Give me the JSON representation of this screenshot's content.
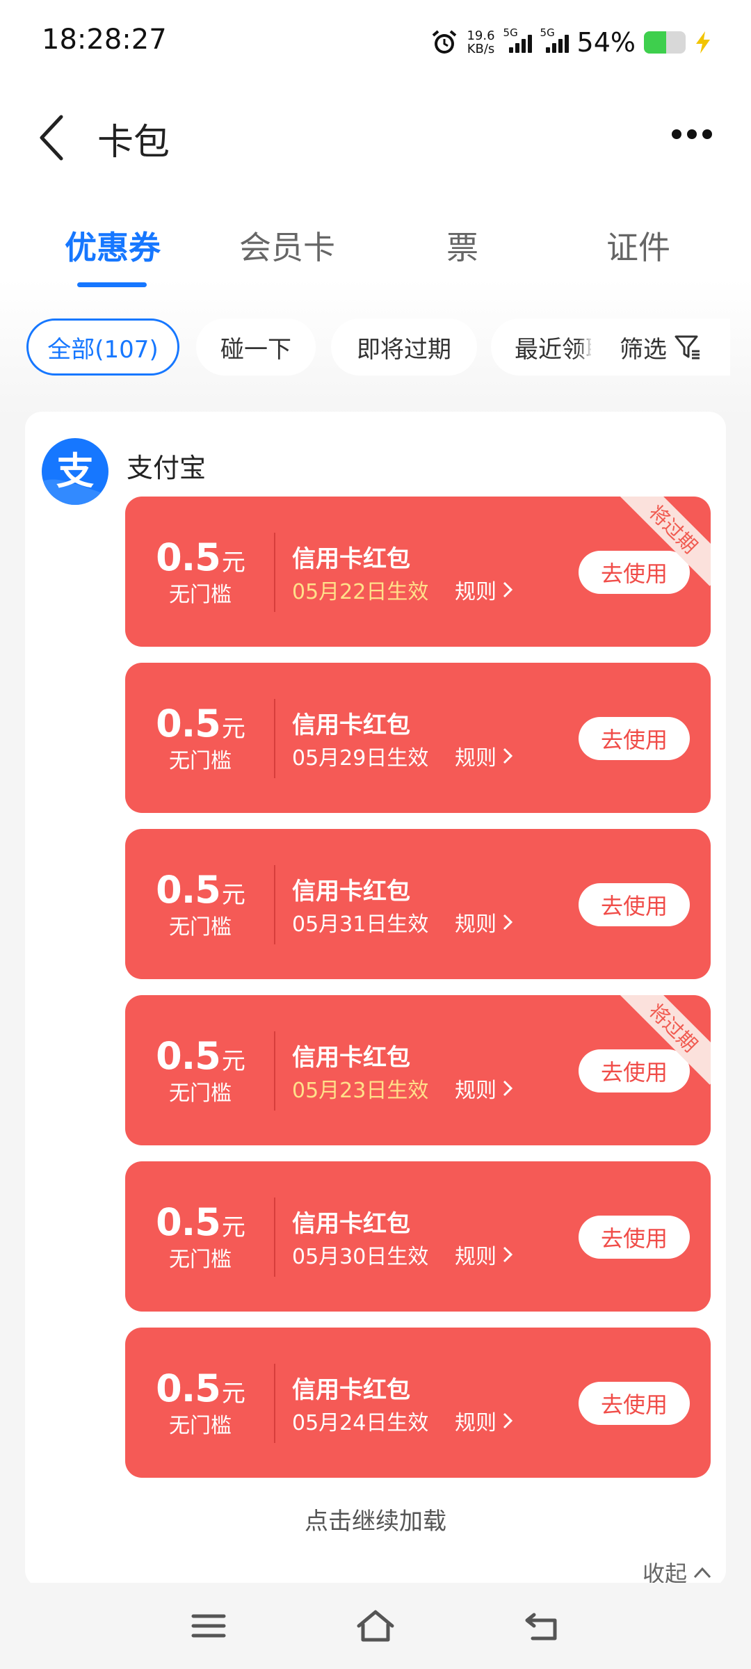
{
  "status_bar": {
    "time": "18:28:27",
    "net_speed_value": "19.6",
    "net_speed_unit": "KB/s",
    "signal1_label": "5G",
    "signal2_label": "5G",
    "battery_percent": "54%"
  },
  "header": {
    "title": "卡包"
  },
  "tabs": [
    {
      "label": "优惠券"
    },
    {
      "label": "会员卡"
    },
    {
      "label": "票"
    },
    {
      "label": "证件"
    }
  ],
  "filters": {
    "chips": [
      {
        "label": "全部(107)"
      },
      {
        "label": "碰一下"
      },
      {
        "label": "即将过期"
      },
      {
        "label": "最近领取"
      }
    ],
    "filter_button": "筛选"
  },
  "merchant": {
    "name": "支付宝",
    "logo_glyph": "支"
  },
  "coupons": [
    {
      "amount": "0.5",
      "unit": "元",
      "threshold": "无门槛",
      "title": "信用卡红包",
      "date": "05月22日生效",
      "rule": "规则",
      "action": "去使用",
      "badge": "将过期"
    },
    {
      "amount": "0.5",
      "unit": "元",
      "threshold": "无门槛",
      "title": "信用卡红包",
      "date": "05月29日生效",
      "rule": "规则",
      "action": "去使用",
      "badge": ""
    },
    {
      "amount": "0.5",
      "unit": "元",
      "threshold": "无门槛",
      "title": "信用卡红包",
      "date": "05月31日生效",
      "rule": "规则",
      "action": "去使用",
      "badge": ""
    },
    {
      "amount": "0.5",
      "unit": "元",
      "threshold": "无门槛",
      "title": "信用卡红包",
      "date": "05月23日生效",
      "rule": "规则",
      "action": "去使用",
      "badge": "将过期"
    },
    {
      "amount": "0.5",
      "unit": "元",
      "threshold": "无门槛",
      "title": "信用卡红包",
      "date": "05月30日生效",
      "rule": "规则",
      "action": "去使用",
      "badge": ""
    },
    {
      "amount": "0.5",
      "unit": "元",
      "threshold": "无门槛",
      "title": "信用卡红包",
      "date": "05月24日生效",
      "rule": "规则",
      "action": "去使用",
      "badge": ""
    }
  ],
  "footer": {
    "load_more": "点击继续加载",
    "collapse": "收起"
  },
  "colors": {
    "accent": "#1677ff",
    "coupon_bg": "#f55a56",
    "expiring_date": "#ffe08a"
  }
}
